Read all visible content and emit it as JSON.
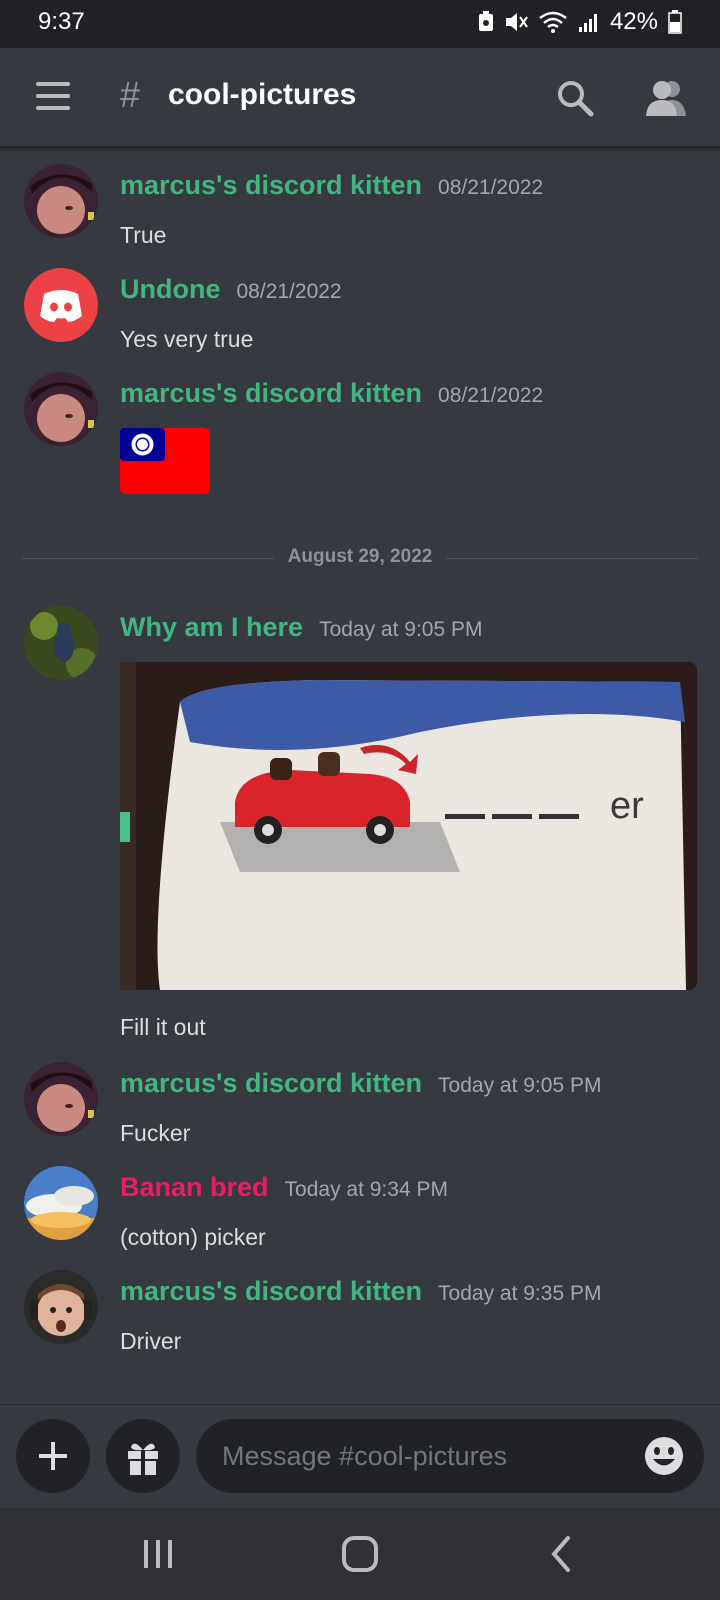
{
  "status_bar": {
    "time": "9:37",
    "battery": "42%"
  },
  "header": {
    "hash": "#",
    "channel": "cool-pictures"
  },
  "messages": [
    {
      "author": "marcus's discord kitten",
      "timestamp": "08/21/2022",
      "text": "True",
      "author_color": "#43b581"
    },
    {
      "author": "Undone",
      "timestamp": "08/21/2022",
      "text": "Yes very true",
      "author_color": "#43b581"
    },
    {
      "author": "marcus's discord kitten",
      "timestamp": "08/21/2022",
      "text": "",
      "author_color": "#43b581"
    },
    {
      "author": "Why am I here",
      "timestamp": "Today at 9:05 PM",
      "text": "Fill it out",
      "author_color": "#43b581"
    },
    {
      "author": "marcus's discord kitten",
      "timestamp": "Today at 9:05 PM",
      "text": "Fucker",
      "author_color": "#43b581"
    },
    {
      "author": "Banan bred",
      "timestamp": "Today at 9:34 PM",
      "text": "(cotton) picker",
      "author_color": "#e91e63"
    },
    {
      "author": "marcus's discord kitten",
      "timestamp": "Today at 9:35 PM",
      "text": "Driver",
      "author_color": "#43b581"
    }
  ],
  "image_attachment": {
    "caption_text": "er"
  },
  "date_divider": "August 29, 2022",
  "composer": {
    "placeholder": "Message #cool-pictures"
  },
  "colors": {
    "background": "#36393f",
    "accent_green": "#43b581",
    "accent_pink": "#e91e63",
    "discord_red": "#ed4245"
  }
}
